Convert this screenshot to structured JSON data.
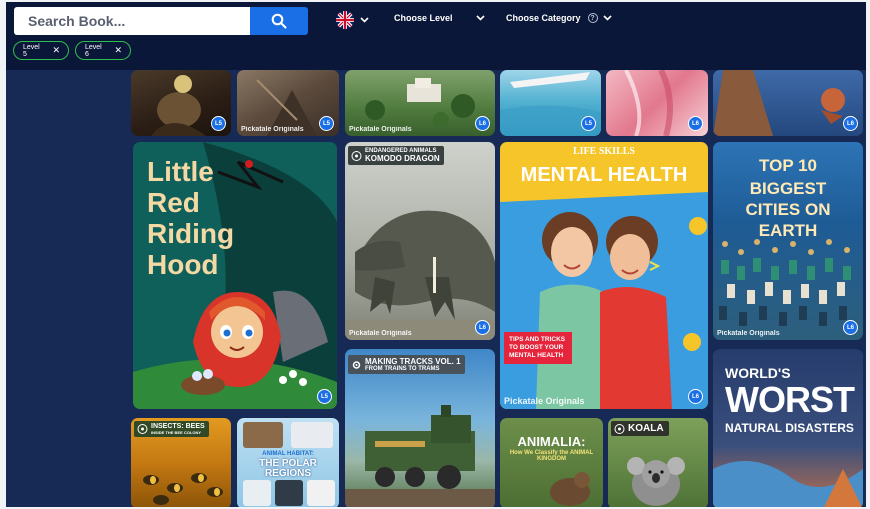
{
  "search": {
    "placeholder": "Search Book..."
  },
  "header": {
    "language_icon": "uk-flag-icon",
    "choose_level": "Choose Level",
    "choose_category": "Choose Category",
    "help_symbol": "?"
  },
  "filters": [
    {
      "label": "Level 5"
    },
    {
      "label": "Level 6"
    }
  ],
  "books": {
    "top_row": [
      {
        "level": "L5"
      },
      {
        "level": "L5"
      },
      {
        "level": "L6"
      },
      {
        "level": "L5"
      },
      {
        "level": "L6"
      },
      {
        "level": "L6"
      }
    ],
    "red_riding_hood": {
      "title": "Little\nRed\nRiding\nHood",
      "level": "L5"
    },
    "komodo": {
      "series": "ENDANGERED ANIMALS",
      "title": "KOMODO DRAGON",
      "brand": "Pickatale Originals",
      "level": "L6"
    },
    "mental_health": {
      "kicker": "LIFE SKILLS",
      "title": "MENTAL HEALTH",
      "tips": "TIPS AND TRICKS TO BOOST YOUR MENTAL HEALTH",
      "brand": "Pickatale Originals",
      "level": "L6"
    },
    "cities": {
      "kicker": "TOP 10",
      "title": "BIGGEST CITIES ON EARTH",
      "brand": "Pickatale Originals",
      "level": "L6"
    },
    "bees": {
      "series": "INSECTS: BEES",
      "subtitle": "INSIDE THE BEE COLONY"
    },
    "polar": {
      "kicker": "ANIMAL HABITAT:",
      "title": "THE POLAR REGIONS"
    },
    "tracks": {
      "title": "MAKING TRACKS VOL. 1",
      "subtitle": "FROM TRAINS TO TRAMS"
    },
    "animalia": {
      "title": "ANIMALIA:",
      "subtitle": "How We Classify the ANIMAL KINGDOM"
    },
    "koala": {
      "title": "KOALA"
    },
    "disasters": {
      "kicker": "WORLD'S",
      "title": "WORST",
      "subtitle": "NATURAL DISASTERS"
    },
    "brand_generic": "Pickatale Originals"
  },
  "colors": {
    "navy": "#0b1738",
    "page": "#172a55",
    "accent": "#1a6fe6",
    "chip_border": "#2fbf4e"
  }
}
